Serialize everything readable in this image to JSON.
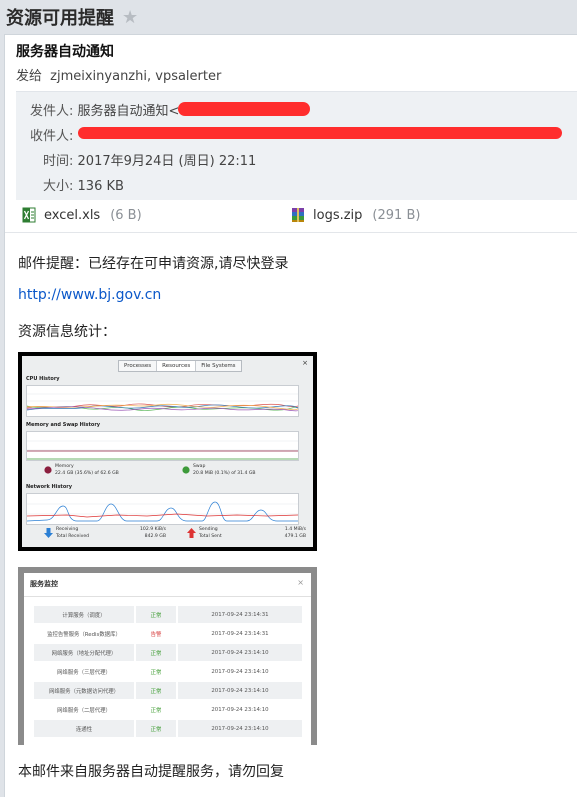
{
  "subject": "资源可用提醒",
  "mail": {
    "title": "服务器自动通知",
    "to_prefix": "发给",
    "to_names": "zjmeixinyanzhi, vpsalerter",
    "meta": {
      "from_label": "发件人:",
      "from_value": "服务器自动通知<",
      "recipient_label": "收件人:",
      "time_label": "时间:",
      "time_value": "2017年9月24日 (周日) 22:11",
      "size_label": "大小:",
      "size_value": "136 KB"
    },
    "attachments": [
      {
        "name": "excel.xls",
        "size": "(6 B)",
        "icon": "excel-file-icon"
      },
      {
        "name": "logs.zip",
        "size": "(291 B)",
        "icon": "zip-archive-icon"
      }
    ],
    "body": {
      "line1": "邮件提醒：已经存在可申请资源,请尽快登录",
      "link": "http://www.bj.gov.cn",
      "line2": "资源信息统计：",
      "footer": "本邮件来自服务器自动提醒服务，请勿回复"
    }
  },
  "monitor": {
    "tabs": [
      "Processes",
      "Resources",
      "File Systems"
    ],
    "close": "×",
    "cpu_title": "CPU History",
    "mem_title": "Memory and Swap History",
    "net_title": "Network History",
    "memory_label": "Memory",
    "memory_value": "22.4 GB (35.6%) of 62.6 GB",
    "swap_label": "Swap",
    "swap_value": "20.8 MiB (0.1%) of 31.4 GB",
    "receiving_label": "Receiving",
    "receiving_rate": "102.9 KiB/s",
    "total_received_label": "Total Received",
    "total_received": "842.9 GB",
    "sending_label": "Sending",
    "sending_rate": "1.4 MiB/s",
    "total_sent_label": "Total Sent",
    "total_sent": "479.1 GB",
    "colors": {
      "memory": "#8b1f3f",
      "swap": "#3d9a3a",
      "receive": "#2b7fd4",
      "send": "#d33"
    }
  },
  "service_panel": {
    "title": "服务监控",
    "close": "×",
    "rows": [
      {
        "name": "计算服务（调度）",
        "status": "正常",
        "time": "2017-09-24 23:14:31",
        "ok": true
      },
      {
        "name": "监控告警服务（Redis数据库）",
        "status": "告警",
        "time": "2017-09-24 23:14:31",
        "ok": false
      },
      {
        "name": "网络服务（地址分配代理）",
        "status": "正常",
        "time": "2017-09-24 23:14:10",
        "ok": true
      },
      {
        "name": "网络服务（三层代理）",
        "status": "正常",
        "time": "2017-09-24 23:14:10",
        "ok": true
      },
      {
        "name": "网络服务（元数据访问代理）",
        "status": "正常",
        "time": "2017-09-24 23:14:10",
        "ok": true
      },
      {
        "name": "网络服务（二层代理）",
        "status": "正常",
        "time": "2017-09-24 23:14:10",
        "ok": true
      },
      {
        "name": "连通性",
        "status": "正常",
        "time": "2017-09-24 23:14:10",
        "ok": true
      }
    ]
  }
}
